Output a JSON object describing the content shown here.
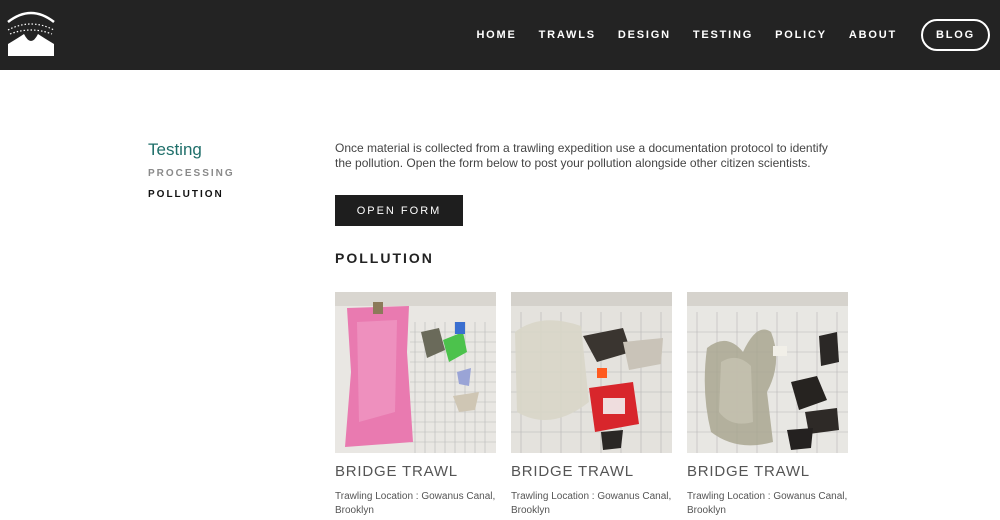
{
  "header": {
    "nav": [
      "HOME",
      "TRAWLS",
      "DESIGN",
      "TESTING",
      "POLICY",
      "ABOUT"
    ],
    "blog": "BLOG"
  },
  "sidebar": {
    "title": "Testing",
    "items": [
      "PROCESSING",
      "POLLUTION"
    ]
  },
  "main": {
    "intro": "Once material is collected from a trawling expedition use a documentation protocol to identify the pollution. Open the form below to post your pollution alongside other citizen scientists.",
    "button": "OPEN FORM",
    "section_title": "POLLUTION",
    "cards": [
      {
        "title": "BRIDGE TRAWL",
        "location_line1": "Trawling Location : Gowanus Canal,",
        "location_line2": "Brooklyn"
      },
      {
        "title": "BRIDGE TRAWL",
        "location_line1": "Trawling Location : Gowanus Canal,",
        "location_line2": "Brooklyn"
      },
      {
        "title": "BRIDGE TRAWL",
        "location_line1": "Trawling Location : Gowanus Canal,",
        "location_line2": "Brooklyn"
      }
    ]
  },
  "colors": {
    "header_bg": "#232323",
    "accent_title": "#1f6f6a",
    "button_bg": "#1e1e1e"
  }
}
